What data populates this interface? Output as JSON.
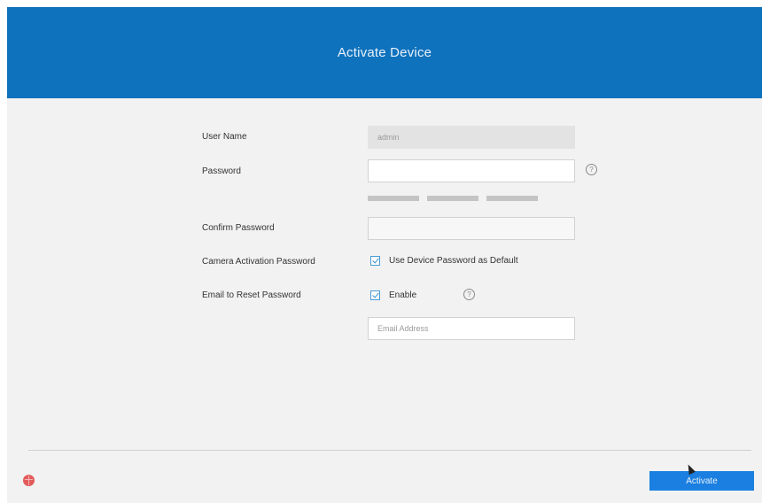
{
  "header": {
    "title": "Activate Device"
  },
  "form": {
    "user_name_label": "User Name",
    "user_name_value": "admin",
    "password_label": "Password",
    "password_value": "",
    "confirm_password_label": "Confirm Password",
    "confirm_password_value": "",
    "camera_activation_label": "Camera Activation Password",
    "use_default_label": "Use Device Password as Default",
    "use_default_checked": true,
    "email_reset_label": "Email to Reset Password",
    "enable_label": "Enable",
    "enable_checked": true,
    "email_placeholder": "Email Address",
    "email_value": ""
  },
  "footer": {
    "activate_label": "Activate"
  },
  "icons": {
    "password_help": "help-circle-icon",
    "email_help": "help-circle-icon",
    "language": "language-globe-icon"
  },
  "colors": {
    "header": "#0f72bd",
    "accent": "#1a7fe0",
    "background": "#f2f2f2"
  }
}
